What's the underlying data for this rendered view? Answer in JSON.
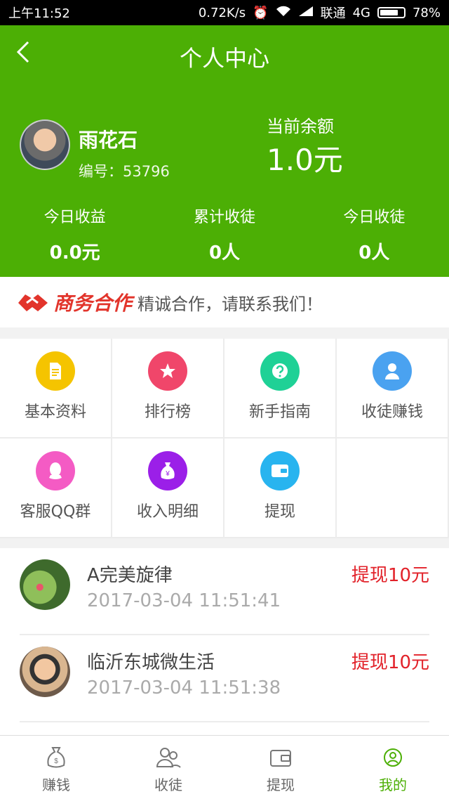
{
  "status": {
    "time": "上午11:52",
    "speed": "0.72K/s",
    "carrier": "联通",
    "network": "4G",
    "battery": "78%",
    "battery_level": 0.78
  },
  "header": {
    "title": "个人中心"
  },
  "profile": {
    "name": "雨花石",
    "id_text": "编号：53796",
    "balance_label": "当前余额",
    "balance_value": "1.0元"
  },
  "stats": [
    {
      "label": "今日收益",
      "value": "0.0元"
    },
    {
      "label": "累计收徒",
      "value": "0人"
    },
    {
      "label": "今日收徒",
      "value": "0人"
    }
  ],
  "banner": {
    "brand": "商务合作",
    "slogan": "精诚合作，请联系我们！"
  },
  "menu": [
    {
      "label": "基本资料",
      "icon": "document-icon",
      "color": "#f5c400"
    },
    {
      "label": "排行榜",
      "icon": "star-icon",
      "color": "#f0466a"
    },
    {
      "label": "新手指南",
      "icon": "question-icon",
      "color": "#1fd196"
    },
    {
      "label": "收徒赚钱",
      "icon": "user-icon",
      "color": "#4aa2f0"
    },
    {
      "label": "客服QQ群",
      "icon": "qq-icon",
      "color": "#f45bc4"
    },
    {
      "label": "收入明细",
      "icon": "money-bag-icon",
      "color": "#9b1fe8"
    },
    {
      "label": "提现",
      "icon": "wallet-icon",
      "color": "#28b4ef"
    }
  ],
  "feed": [
    {
      "name": "A完美旋律",
      "time": "2017-03-04 11:51:41",
      "amount": "提现10元"
    },
    {
      "name": "临沂东城微生活",
      "time": "2017-03-04 11:51:38",
      "amount": "提现10元"
    }
  ],
  "tabs": [
    {
      "label": "赚钱",
      "icon": "money-bag-icon"
    },
    {
      "label": "收徒",
      "icon": "users-icon"
    },
    {
      "label": "提现",
      "icon": "wallet-icon"
    },
    {
      "label": "我的",
      "icon": "profile-icon",
      "active": true
    }
  ],
  "colors": {
    "primary": "#4caf05",
    "accent_red": "#e2222a"
  }
}
